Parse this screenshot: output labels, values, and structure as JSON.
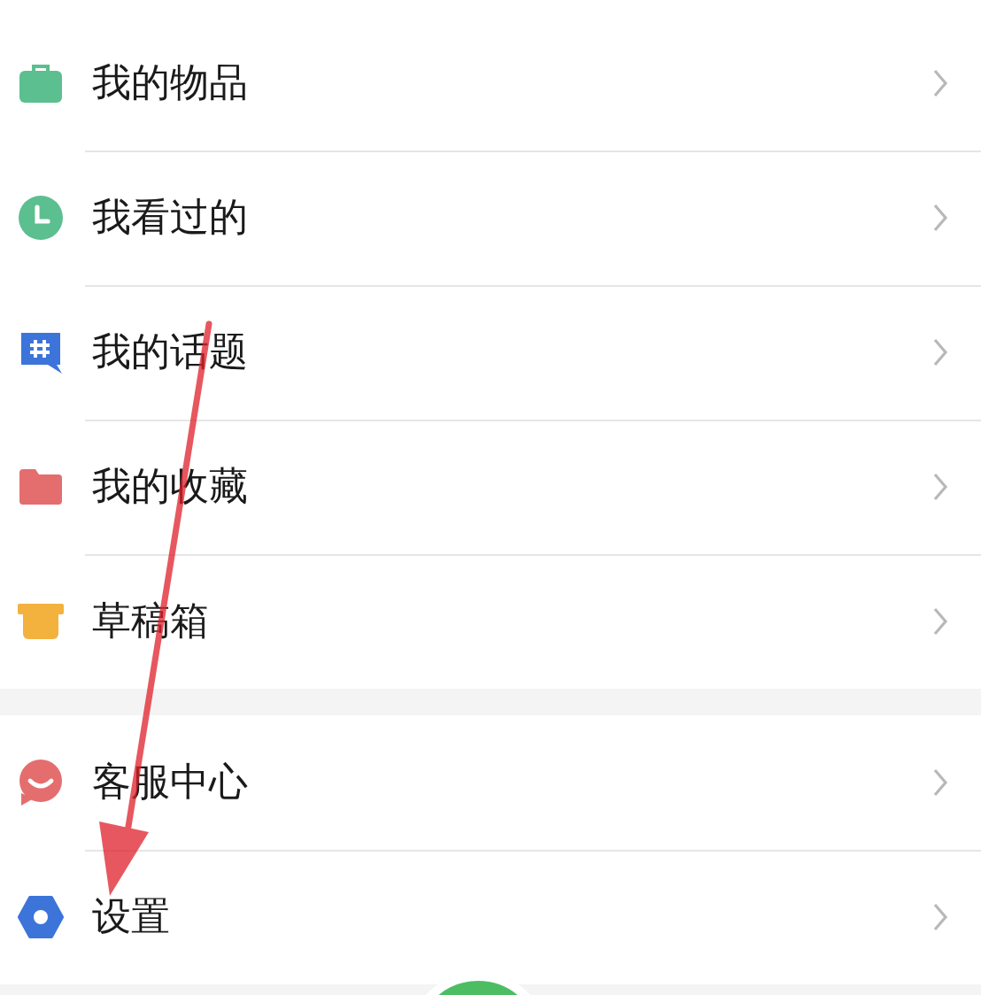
{
  "sections": [
    {
      "items": [
        {
          "label": "我的物品"
        },
        {
          "label": "我看过的"
        },
        {
          "label": "我的话题"
        },
        {
          "label": "我的收藏"
        },
        {
          "label": "草稿箱"
        }
      ]
    },
    {
      "items": [
        {
          "label": "客服中心"
        },
        {
          "label": "设置"
        }
      ]
    }
  ]
}
